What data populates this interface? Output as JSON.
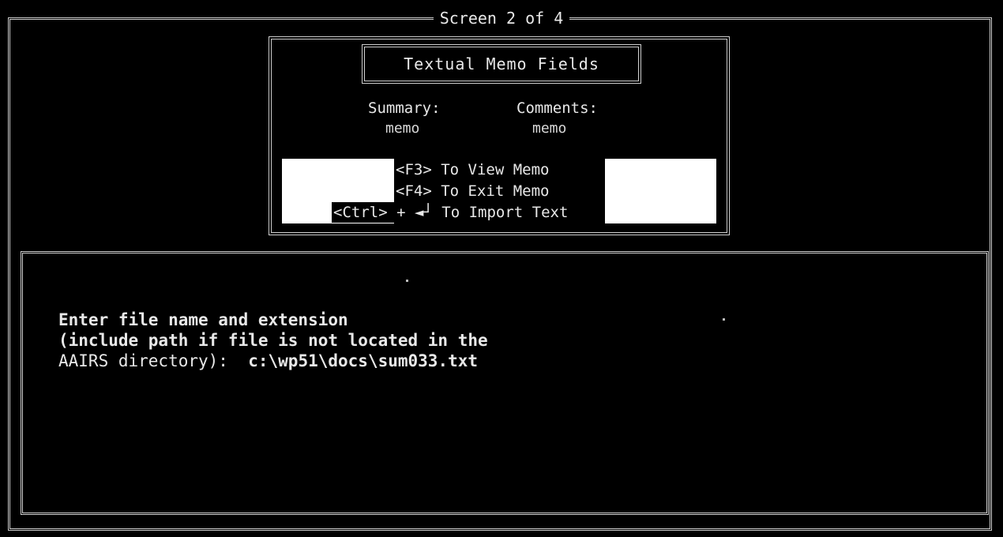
{
  "screen": {
    "title": "Screen 2 of 4"
  },
  "memo": {
    "heading": "Textual Memo Fields",
    "fields": [
      {
        "label": "Summary:",
        "value": "memo"
      },
      {
        "label": "Comments:",
        "value": "memo"
      }
    ],
    "keys": {
      "view": "<F3> To View Memo",
      "exit": "<F4> To Exit Memo",
      "import": "<Ctrl> + ◄┘ To Import Text"
    }
  },
  "prompt": {
    "line1": "Enter file name and extension",
    "line2": "(include path if file is not located in the",
    "line3_label": "AAIRS directory):",
    "file_path": "c:\\wp51\\docs\\sum033.txt"
  }
}
